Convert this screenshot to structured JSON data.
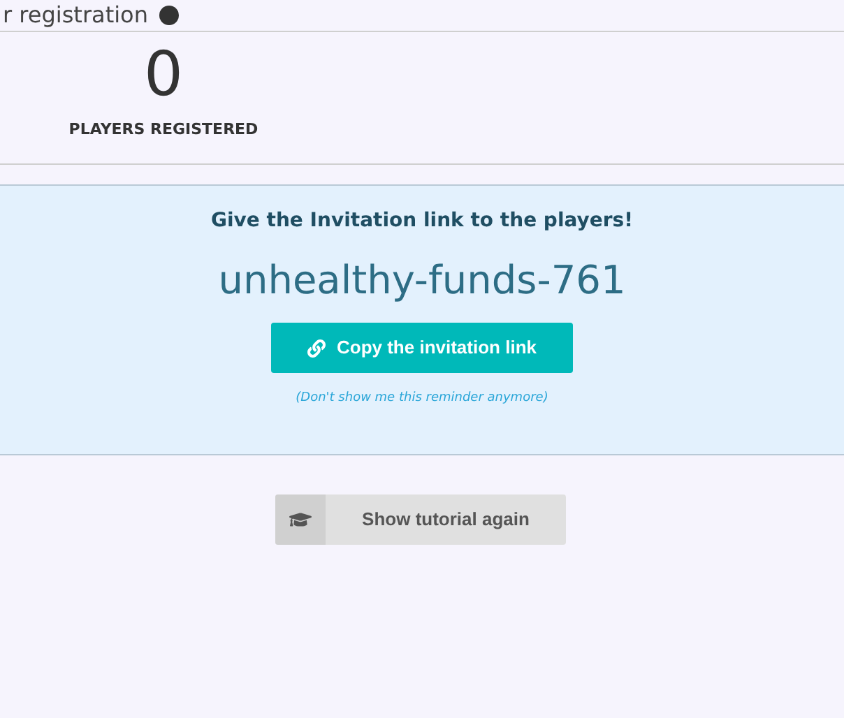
{
  "header": {
    "title": "r registration"
  },
  "stats": [
    {
      "value": "0",
      "label": "PLAYERS REGISTERED"
    }
  ],
  "invitation": {
    "heading": "Give the Invitation link to the players!",
    "code": "unhealthy-funds-761",
    "copy_button": "Copy the invitation link",
    "dismiss_link": "(Don't show me this reminder anymore)"
  },
  "tutorial_button": "Show tutorial again"
}
